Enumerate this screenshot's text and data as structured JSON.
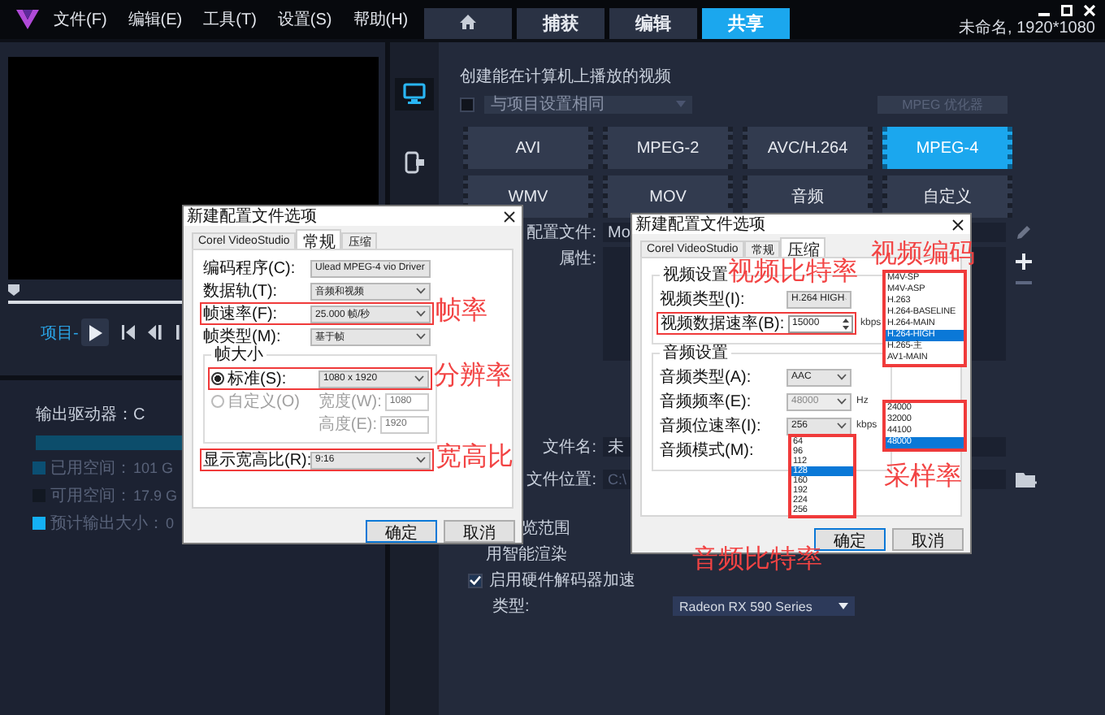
{
  "menu": [
    "文件(F)",
    "编辑(E)",
    "工具(T)",
    "设置(S)",
    "帮助(H)"
  ],
  "tabs": [
    {
      "kind": "home",
      "selected": false
    },
    {
      "kind": "text",
      "label": "捕获",
      "selected": false
    },
    {
      "kind": "text",
      "label": "编辑",
      "selected": false
    },
    {
      "kind": "text",
      "label": "共享",
      "selected": true
    }
  ],
  "project_info": "未命名, 1920*1080",
  "player": {
    "scrubber": {
      "level": 0
    },
    "project_label": "项目-"
  },
  "output": {
    "drive_label": "输出驱动器：C",
    "legend": [
      {
        "label": "已用空间：",
        "value": "101 G",
        "color": "#0b4f73"
      },
      {
        "label": "可用空间：",
        "value": "17.9 G",
        "color": "#121822"
      },
      {
        "label": "预计输出大小：",
        "value": "0",
        "color": "#14b0f5"
      }
    ]
  },
  "side_icons": [
    {
      "kind": "computer",
      "selected": true
    },
    {
      "kind": "device",
      "selected": false
    }
  ],
  "share": {
    "title": "创建能在计算机上播放的视频",
    "same_as_project": {
      "checked": false,
      "value": "与项目设置相同"
    },
    "optimizer_button": "MPEG 优化器",
    "formats": [
      {
        "label": "AVI",
        "selected": false
      },
      {
        "label": "MPEG-2",
        "selected": false
      },
      {
        "label": "AVC/H.264",
        "selected": false
      },
      {
        "label": "MPEG-4",
        "selected": true
      },
      {
        "label": "WMV",
        "selected": false
      },
      {
        "label": "MOV",
        "selected": false
      },
      {
        "label": "音频",
        "selected": false
      },
      {
        "label": "自定义",
        "selected": false
      }
    ],
    "profile": {
      "label": "配置文件:",
      "value": "Mo"
    },
    "properties_label": "属性:",
    "file_name": {
      "label": "文件名:",
      "value": "未"
    },
    "file_location": {
      "label": "文件位置:",
      "value": "C:\\"
    },
    "options": [
      {
        "text": "览范围"
      },
      {
        "text": "用智能渲染"
      },
      {
        "text": "启用硬件解码器加速",
        "checked": true
      }
    ],
    "decoder_type": {
      "label": "类型:",
      "value": "Radeon RX 590 Series"
    }
  },
  "general_dialog": {
    "title": "新建配置文件选项",
    "tabs": [
      {
        "label": "Corel VideoStudio",
        "selected": false
      },
      {
        "label": "常规",
        "selected": true
      },
      {
        "label": "压缩",
        "selected": false
      }
    ],
    "rows": [
      {
        "label": "编码程序(C):",
        "value": "Ulead MPEG-4 vio Driver",
        "highlighted": false
      },
      {
        "label": "数据轨(T):",
        "value": "音频和视频",
        "highlighted": false
      },
      {
        "label": "帧速率(F):",
        "value": "25.000 帧/秒",
        "highlighted": true,
        "annotation": "帧率"
      },
      {
        "label": "帧类型(M):",
        "value": "基于帧",
        "highlighted": false
      }
    ],
    "frame_size": {
      "title": "帧大小",
      "options": [
        {
          "label": "标准(S):",
          "selected": true,
          "disabled": false,
          "value": "1080 x 1920",
          "highlighted": true,
          "annotation": "分辨率"
        },
        {
          "label": "自定义(O)",
          "selected": false,
          "disabled": true
        }
      ],
      "width": {
        "label": "宽度(W):",
        "value": "1080"
      },
      "height": {
        "label": "高度(E):",
        "value": "1920"
      }
    },
    "aspect": {
      "label": "显示宽高比(R):",
      "value": "9:16",
      "highlighted": true,
      "annotation": "宽高比"
    },
    "buttons": [
      {
        "label": "确定",
        "default": true
      },
      {
        "label": "取消",
        "default": false
      }
    ]
  },
  "compression_dialog": {
    "title": "新建配置文件选项",
    "tabs": [
      {
        "label": "Corel VideoStudio",
        "selected": false
      },
      {
        "label": "常规",
        "selected": false
      },
      {
        "label": "压缩",
        "selected": true
      }
    ],
    "groups": [
      {
        "title": "视频设置",
        "rows": [
          {
            "kind": "select",
            "label": "视频类型(I):",
            "value": "H.264 HIGH",
            "disabled": false,
            "highlighted": false
          },
          {
            "kind": "spin",
            "label": "视频数据速率(B):",
            "value": "15000",
            "unit": "kbps",
            "disabled": false,
            "highlighted": true,
            "annotation": "视频比特率"
          }
        ]
      },
      {
        "title": "音频设置",
        "rows": [
          {
            "kind": "select",
            "label": "音频类型(A):",
            "value": "AAC",
            "disabled": false,
            "highlighted": false
          },
          {
            "kind": "select",
            "label": "音频频率(E):",
            "value": "48000",
            "unit": "Hz",
            "disabled": true,
            "highlighted": false
          },
          {
            "kind": "select",
            "label": "音频位速率(I):",
            "value": "256",
            "unit": "kbps",
            "disabled": false,
            "highlighted": false,
            "list": {
              "highlighted": true,
              "annotation": "音频比特率",
              "items": [
                {
                  "label": "64",
                  "selected": false
                },
                {
                  "label": "96",
                  "selected": false
                },
                {
                  "label": "112",
                  "selected": false
                },
                {
                  "label": "128",
                  "selected": true
                },
                {
                  "label": "160",
                  "selected": false
                },
                {
                  "label": "192",
                  "selected": false
                },
                {
                  "label": "224",
                  "selected": false
                },
                {
                  "label": "256",
                  "selected": false
                }
              ]
            }
          },
          {
            "kind": "label",
            "label": "音频模式(M):"
          }
        ]
      }
    ],
    "codec_list": {
      "highlighted": true,
      "annotation": "视频编码",
      "items": [
        {
          "label": "M4V-SP",
          "selected": false
        },
        {
          "label": "M4V-ASP",
          "selected": false
        },
        {
          "label": "H.263",
          "selected": false
        },
        {
          "label": "H.264-BASELINE",
          "selected": false
        },
        {
          "label": "H.264-MAIN",
          "selected": false
        },
        {
          "label": "H.264-HIGH",
          "selected": true
        },
        {
          "label": "H.265-主",
          "selected": false
        },
        {
          "label": "AV1-MAIN",
          "selected": false
        }
      ]
    },
    "sample_rate_list": {
      "highlighted": true,
      "annotation": "采样率",
      "items": [
        {
          "label": "24000",
          "selected": false
        },
        {
          "label": "32000",
          "selected": false
        },
        {
          "label": "44100",
          "selected": false
        },
        {
          "label": "48000",
          "selected": true
        }
      ]
    },
    "buttons": [
      {
        "label": "确定",
        "default": true
      },
      {
        "label": "取消",
        "default": false
      }
    ]
  }
}
